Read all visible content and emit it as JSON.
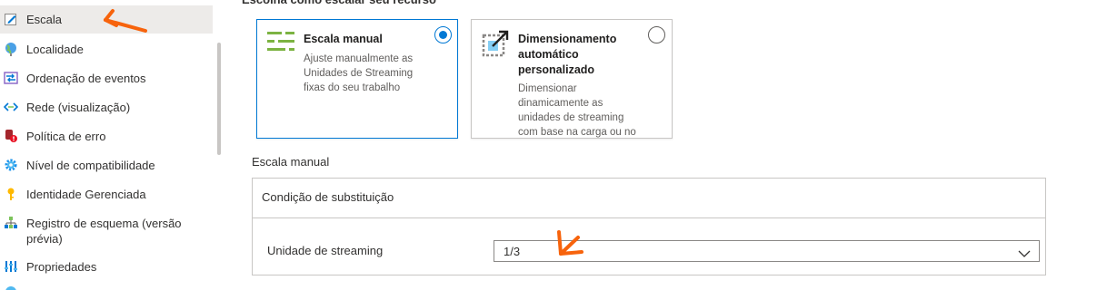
{
  "sidebar": {
    "items": [
      {
        "label": "Escala",
        "icon": "edit-scale-icon",
        "active": true
      },
      {
        "label": "Localidade",
        "icon": "globe-icon"
      },
      {
        "label": "Ordenação de eventos",
        "icon": "event-ordering-icon"
      },
      {
        "label": "Rede (visualização)",
        "icon": "network-icon"
      },
      {
        "label": "Política de erro",
        "icon": "error-policy-icon"
      },
      {
        "label": "Nível de compatibilidade",
        "icon": "gear-icon"
      },
      {
        "label": "Identidade Gerenciada",
        "icon": "key-icon"
      },
      {
        "label": "Registro de esquema (versão prévia)",
        "icon": "schema-registry-icon"
      },
      {
        "label": "Propriedades",
        "icon": "properties-icon"
      }
    ]
  },
  "main": {
    "heading": "Escolha como escalar seu recurso",
    "options": [
      {
        "title": "Escala manual",
        "desc_lines": [
          "Ajuste manualmente as",
          "Unidades de Streaming",
          "fixas do seu trabalho"
        ],
        "selected": true,
        "icon": "manual-scale-icon"
      },
      {
        "title_lines": [
          "Dimensionamento",
          "automático",
          "personalizado"
        ],
        "desc_lines": [
          "Dimensionar",
          "dinamicamente as",
          "unidades de streaming",
          "com base na carga ou no"
        ],
        "selected": false,
        "icon": "autoscale-icon"
      }
    ],
    "section_label": "Escala manual",
    "panel_header": "Condição de substituição",
    "field_label": "Unidade de streaming",
    "dropdown_value": "1/3"
  },
  "colors": {
    "accent": "#0078d4",
    "annotation": "#f7630c",
    "selected_nav": "#edebe9"
  }
}
